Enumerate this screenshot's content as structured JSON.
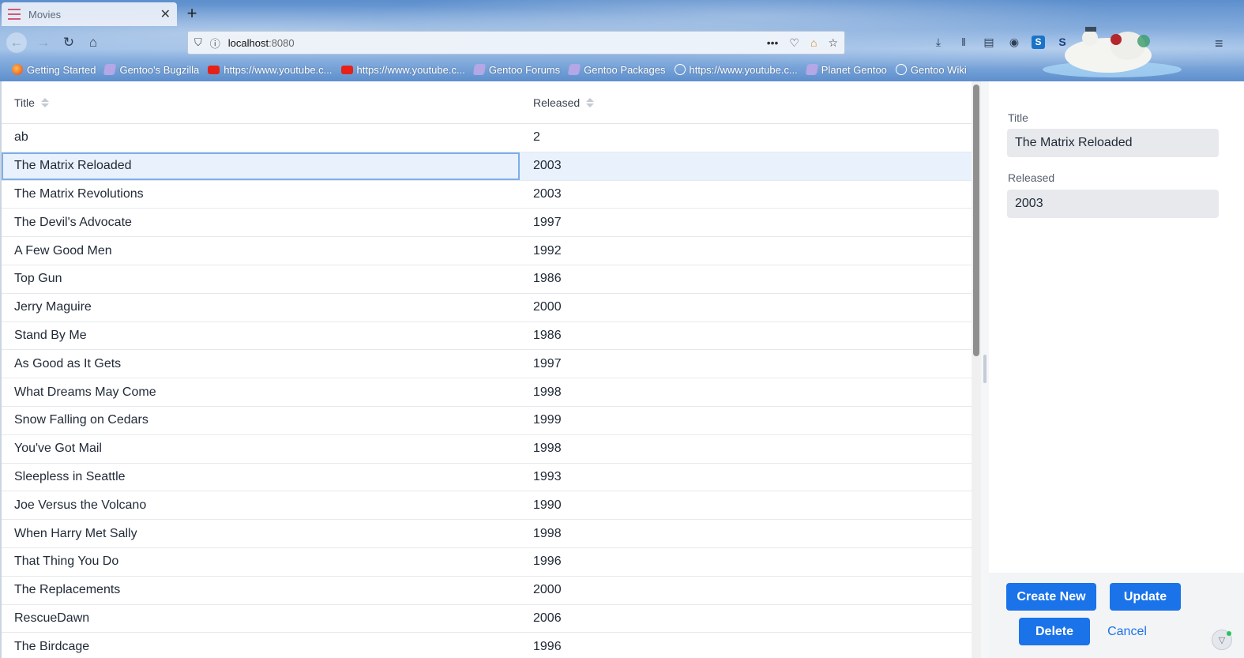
{
  "browser": {
    "tab_title": "Movies",
    "url_host": "localhost",
    "url_port": ":8080",
    "icons": {
      "back": "back-arrow-icon",
      "forward": "forward-arrow-icon",
      "reload": "reload-icon",
      "home": "home-icon",
      "shield": "shield-icon",
      "info": "info-icon",
      "more": "more-dots-icon",
      "pocket": "pocket-icon",
      "star": "star-icon",
      "menu": "hamburger-menu-icon"
    },
    "bookmarks": [
      {
        "label": "Getting Started",
        "icon": "firefox-icon"
      },
      {
        "label": "Gentoo's Bugzilla",
        "icon": "gentoo-icon"
      },
      {
        "label": "https://www.youtube.c...",
        "icon": "youtube-icon"
      },
      {
        "label": "https://www.youtube.c...",
        "icon": "youtube-icon"
      },
      {
        "label": "Gentoo Forums",
        "icon": "gentoo-icon"
      },
      {
        "label": "Gentoo Packages",
        "icon": "gentoo-icon"
      },
      {
        "label": "https://www.youtube.c...",
        "icon": "globe-icon"
      },
      {
        "label": "Planet Gentoo",
        "icon": "gentoo-icon"
      },
      {
        "label": "Gentoo Wiki",
        "icon": "globe-icon"
      }
    ]
  },
  "table": {
    "columns": [
      "Title",
      "Released"
    ],
    "selected_index": 1,
    "rows": [
      {
        "title": "ab",
        "released": "2"
      },
      {
        "title": "The Matrix Reloaded",
        "released": "2003"
      },
      {
        "title": "The Matrix Revolutions",
        "released": "2003"
      },
      {
        "title": "The Devil's Advocate",
        "released": "1997"
      },
      {
        "title": "A Few Good Men",
        "released": "1992"
      },
      {
        "title": "Top Gun",
        "released": "1986"
      },
      {
        "title": "Jerry Maguire",
        "released": "2000"
      },
      {
        "title": "Stand By Me",
        "released": "1986"
      },
      {
        "title": "As Good as It Gets",
        "released": "1997"
      },
      {
        "title": "What Dreams May Come",
        "released": "1998"
      },
      {
        "title": "Snow Falling on Cedars",
        "released": "1999"
      },
      {
        "title": "You've Got Mail",
        "released": "1998"
      },
      {
        "title": "Sleepless in Seattle",
        "released": "1993"
      },
      {
        "title": "Joe Versus the Volcano",
        "released": "1990"
      },
      {
        "title": "When Harry Met Sally",
        "released": "1998"
      },
      {
        "title": "That Thing You Do",
        "released": "1996"
      },
      {
        "title": "The Replacements",
        "released": "2000"
      },
      {
        "title": "RescueDawn",
        "released": "2006"
      },
      {
        "title": "The Birdcage",
        "released": "1996"
      }
    ]
  },
  "form": {
    "title_label": "Title",
    "title_value": "The Matrix Reloaded",
    "released_label": "Released",
    "released_value": "2003",
    "create_label": "Create New",
    "update_label": "Update",
    "delete_label": "Delete",
    "cancel_label": "Cancel"
  },
  "colors": {
    "primary": "#1a73e8",
    "selected_row": "#e8f1fc",
    "input_bg": "#e7e9ec"
  }
}
